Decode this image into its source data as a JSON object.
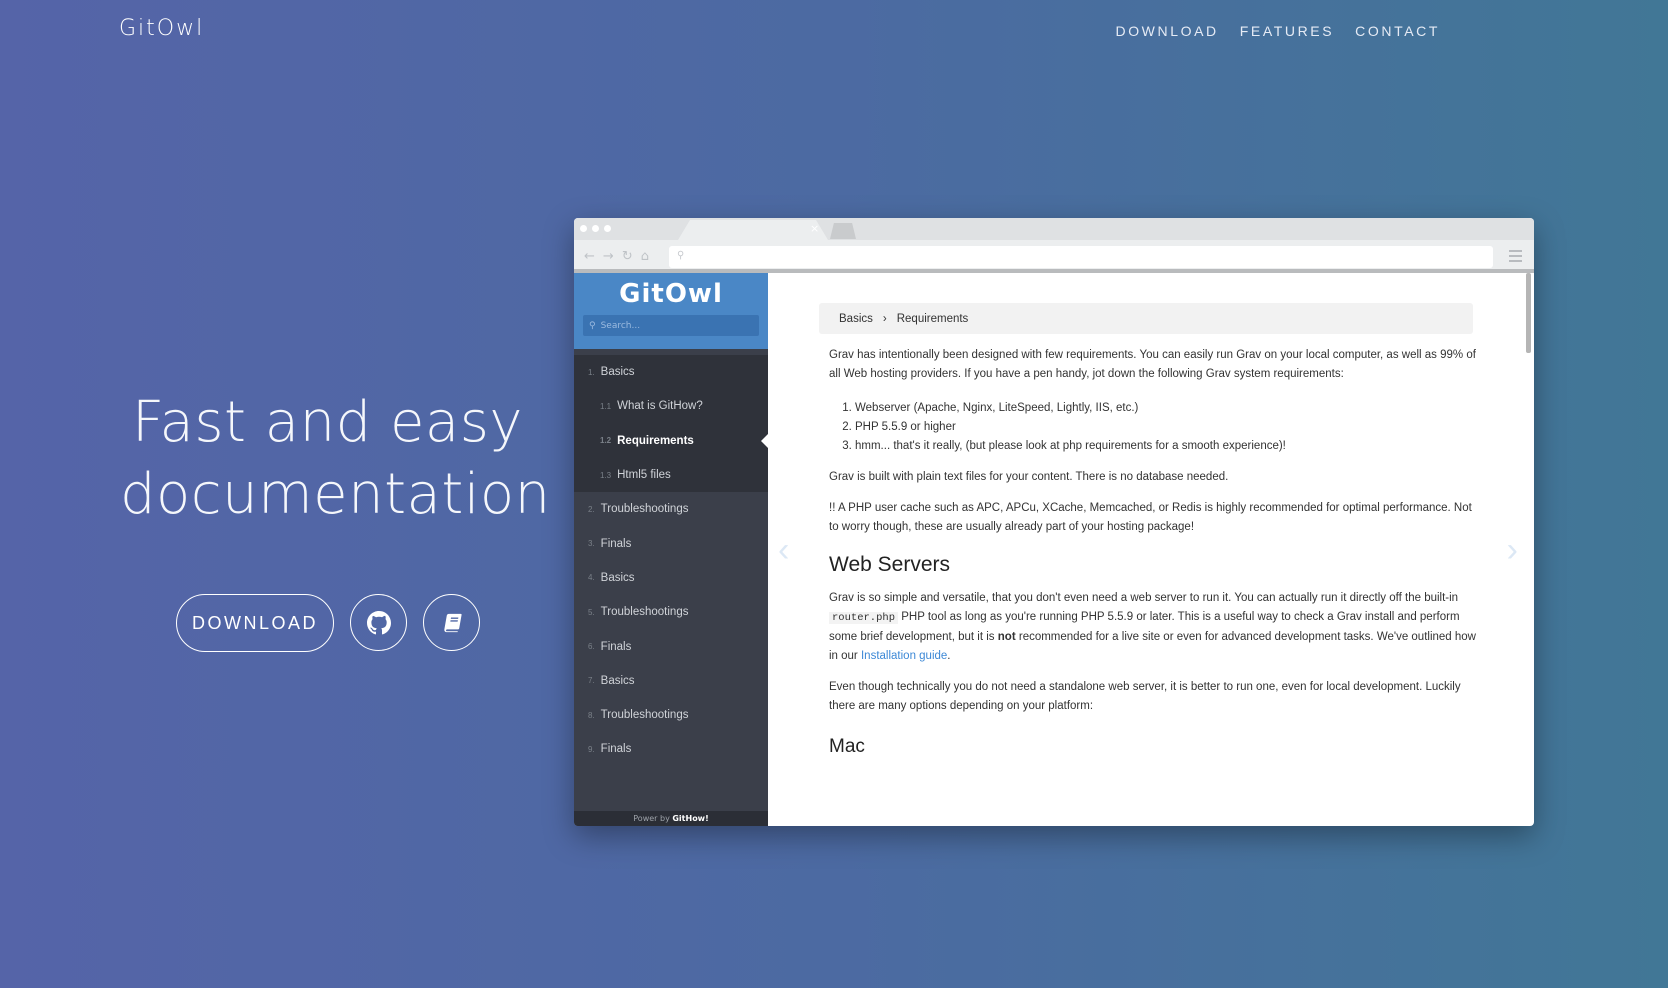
{
  "brand": "GitOwl",
  "nav": {
    "items": [
      "DOWNLOAD",
      "FEATURES",
      "CONTACT"
    ]
  },
  "hero": {
    "title_line1": "Fast and easy",
    "title_line2": "documentation",
    "download_label": "DOWNLOAD"
  },
  "browser": {
    "sidebar": {
      "logo": "GitOwl",
      "search_placeholder": "Search...",
      "items": [
        {
          "num": "1.",
          "label": "Basics"
        },
        {
          "num": "1.1",
          "label": "What is GitHow?"
        },
        {
          "num": "1.2",
          "label": "Requirements"
        },
        {
          "num": "1.3",
          "label": "Html5 files"
        },
        {
          "num": "2.",
          "label": "Troubleshootings"
        },
        {
          "num": "3.",
          "label": "Finals"
        },
        {
          "num": "4.",
          "label": "Basics"
        },
        {
          "num": "5.",
          "label": "Troubleshootings"
        },
        {
          "num": "6.",
          "label": "Finals"
        },
        {
          "num": "7.",
          "label": "Basics"
        },
        {
          "num": "8.",
          "label": "Troubleshootings"
        },
        {
          "num": "9.",
          "label": "Finals"
        }
      ],
      "footer_prefix": "Power by",
      "footer_brand": "GitHow!"
    },
    "content": {
      "breadcrumb": [
        "Basics",
        "Requirements"
      ],
      "intro": "Grav has intentionally been designed with few requirements. You can easily run Grav on your local computer, as well as 99% of all Web hosting providers. If you have a pen handy, jot down the following Grav system requirements:",
      "list": [
        "Webserver (Apache, Nginx, LiteSpeed, Lightly, IIS, etc.)",
        "PHP 5.5.9 or higher",
        "hmm... that's it really, (but please look at php requirements for a smooth experience)!"
      ],
      "p2": "Grav is built with plain text files for your content. There is no database needed.",
      "p3": "!! A PHP user cache such as APC, APCu, XCache, Memcached, or Redis is highly recommended for optimal performance. Not to worry though, these are usually already part of your hosting package!",
      "h_webservers": "Web Servers",
      "p4_a": "Grav is so simple and versatile, that you don't even need a web server to run it. You can actually run it directly off the built-in",
      "p4_code": "router.php",
      "p4_b": "PHP tool as long as you're running PHP 5.5.9 or later. This is a useful way to check a Grav install and perform some brief development, but it is",
      "p4_bold": "not",
      "p4_c": "recommended for a live site or even for advanced development tasks. We've outlined how in our",
      "p4_link": "Installation guide",
      "p4_end": ".",
      "p5": "Even though technically you do not need a standalone web server, it is better to run one, even for local development. Luckily there are many options depending on your platform:",
      "h_mac": "Mac"
    }
  }
}
